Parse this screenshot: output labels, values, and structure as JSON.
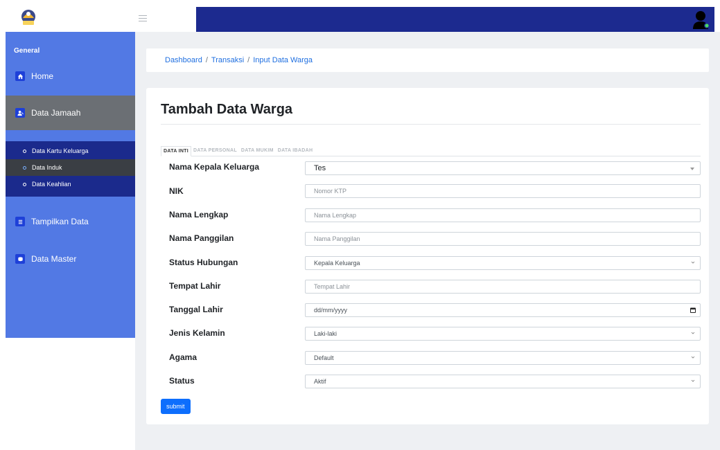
{
  "sidebar": {
    "section_label": "General",
    "items": [
      {
        "label": "Home",
        "icon": "home-icon"
      },
      {
        "label": "Data Jamaah",
        "icon": "user-icon",
        "active": true
      },
      {
        "label": "Tampilkan Data",
        "icon": "list-icon"
      },
      {
        "label": "Data Master",
        "icon": "database-icon"
      }
    ],
    "submenu": [
      {
        "label": "Data Kartu Keluarga"
      },
      {
        "label": "Data Induk",
        "active": true
      },
      {
        "label": "Data Keahlian"
      }
    ]
  },
  "breadcrumb": [
    "Dashboard",
    "Transaksi",
    "Input Data Warga"
  ],
  "page_title": "Tambah Data Warga",
  "tabs": [
    "DATA INTI",
    "DATA PERSONAL",
    "DATA MUKIM",
    "DATA IBADAH"
  ],
  "form": {
    "fields": [
      {
        "label": "Nama Kepala Keluarga",
        "value": "Tes",
        "type": "select2"
      },
      {
        "label": "NIK",
        "placeholder": "Nomor KTP",
        "type": "text"
      },
      {
        "label": "Nama Lengkap",
        "placeholder": "Nama Lengkap",
        "type": "text"
      },
      {
        "label": "Nama Panggilan",
        "placeholder": "Nama Panggilan",
        "type": "text"
      },
      {
        "label": "Status Hubungan",
        "value": "Kepala Keluarga",
        "type": "select"
      },
      {
        "label": "Tempat Lahir",
        "placeholder": "Tempat Lahir",
        "type": "text"
      },
      {
        "label": "Tanggal Lahir",
        "value": "dd/mm/yyyy",
        "type": "date"
      },
      {
        "label": "Jenis Kelamin",
        "value": "Laki-laki",
        "type": "select"
      },
      {
        "label": "Agama",
        "value": "Default",
        "type": "select"
      },
      {
        "label": "Status",
        "value": "Aktif",
        "type": "select"
      }
    ],
    "submit_label": "submit"
  },
  "colors": {
    "topbar": "#1c2a8f",
    "sidebar": "#5279e4",
    "submenu": "#1b2a8c",
    "primary_button": "#0d6efd"
  }
}
